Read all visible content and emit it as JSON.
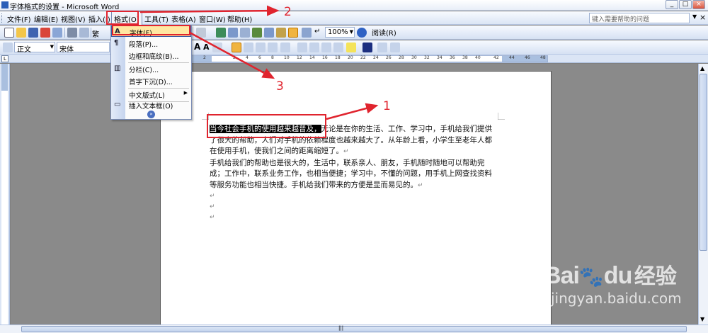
{
  "window": {
    "title": "字体格式的设置 - Microsoft Word",
    "controls": [
      "_",
      "□",
      "×"
    ]
  },
  "menubar": {
    "items": [
      "文件(F)",
      "编辑(E)",
      "视图(V)",
      "插入(I)",
      "格式(O)",
      "工具(T)",
      "表格(A)",
      "窗口(W)",
      "帮助(H)"
    ],
    "help_placeholder": "键入需要帮助的问题",
    "close_glyph": "×"
  },
  "toolbar1": {
    "zoom": "100%",
    "reading_label": "阅读(R)",
    "traditional_label": "繁"
  },
  "toolbar2": {
    "style": "正文",
    "font": "宋体",
    "bold_label": "A",
    "italic_label": "A"
  },
  "ruler": {
    "corner": "L",
    "ticks": [
      "2",
      "2",
      "4",
      "6",
      "8",
      "10",
      "12",
      "14",
      "16",
      "18",
      "20",
      "22",
      "24",
      "26",
      "28",
      "30",
      "32",
      "34",
      "36",
      "38",
      "40",
      "42",
      "44",
      "46",
      "48"
    ]
  },
  "format_menu": {
    "items": [
      {
        "icon": "A",
        "label": "字体(F)..."
      },
      {
        "icon": "¶",
        "label": "段落(P)..."
      },
      {
        "icon": "",
        "label": "边框和底纹(B)..."
      },
      {
        "icon": "▥",
        "label": "分栏(C)..."
      },
      {
        "icon": "",
        "label": "首字下沉(D)..."
      },
      {
        "icon": "",
        "label": "中文版式(L)"
      },
      {
        "icon": "▭",
        "label": "插入文本框(O)"
      }
    ],
    "expand_glyph": "»"
  },
  "document": {
    "selected_text": "当今社会手机的使用越来越普及，",
    "para1_rest": "无论是在你的生活、工作、学习中，手机给我们提供了很大的帮助，人们对手机的依赖程度也越来越大了。从年龄上看，小学生至老年人都在使用手机，使我们之间的距离缩短了。",
    "para2": "手机给我们的帮助也是很大的，生活中，联系亲人、朋友，手机随时随地可以帮助完成；工作中，联系业务工作，也相当便捷；学习中，不懂的问题，用手机上网查找资料等服务功能也相当快捷。手机给我们带来的方便是显而易见的。",
    "para_mark": "↵"
  },
  "annotations": {
    "label1": "1",
    "label2": "2",
    "label3": "3",
    "color": "#e0242e"
  },
  "watermark": {
    "logo": "Bai",
    "logo2": "du",
    "cn": "经验",
    "url": "jingyan.baidu.com"
  },
  "scrollbar": {
    "up": "▲",
    "down": "▼",
    "grip": "|||"
  }
}
